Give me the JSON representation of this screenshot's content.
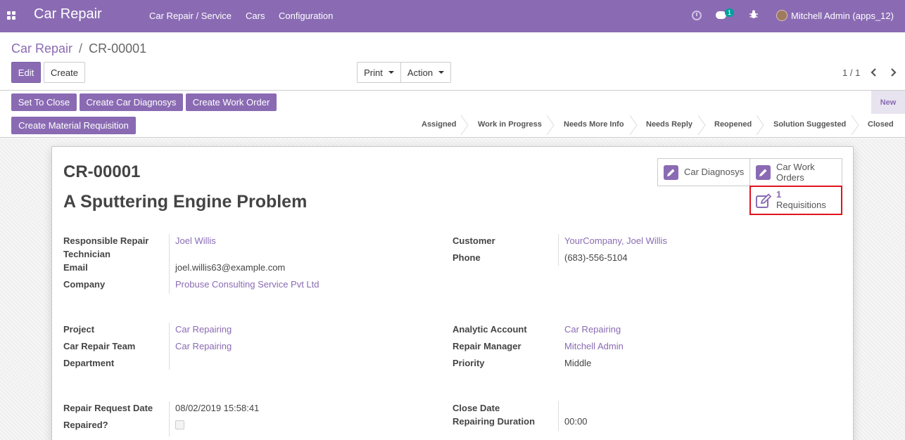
{
  "navbar": {
    "app_title": "Car Repair",
    "menu": [
      "Car Repair / Service",
      "Cars",
      "Configuration"
    ],
    "chat_count": "1",
    "user": "Mitchell Admin (apps_12)"
  },
  "breadcrumb": {
    "parent": "Car Repair",
    "separator": "/",
    "current": "CR-00001"
  },
  "buttons": {
    "edit": "Edit",
    "create": "Create",
    "print": "Print",
    "action": "Action"
  },
  "pager": "1 / 1",
  "header_buttons": {
    "set_to_close": "Set To Close",
    "create_diagnosys": "Create Car Diagnosys",
    "create_work_order": "Create Work Order",
    "create_material_requisition": "Create Material Requisition"
  },
  "stages": [
    "Assigned",
    "Work in Progress",
    "Needs More Info",
    "Needs Reply",
    "Reopened",
    "Solution Suggested",
    "Closed"
  ],
  "current_stage": "New",
  "record": {
    "name": "CR-00001",
    "subject": "A Sputtering Engine Problem"
  },
  "smart_buttons": {
    "diagnosys": "Car Diagnosys",
    "work_orders": "Car Work Orders",
    "requisitions_count": "1",
    "requisitions_label": "Requisitions"
  },
  "fields": {
    "responsible_label": "Responsible Repair Technician",
    "responsible_value": "Joel Willis",
    "email_label": "Email",
    "email_value": "joel.willis63@example.com",
    "company_label": "Company",
    "company_value": "Probuse Consulting Service Pvt Ltd",
    "customer_label": "Customer",
    "customer_value": "YourCompany, Joel Willis",
    "phone_label": "Phone",
    "phone_value": "(683)-556-5104",
    "project_label": "Project",
    "project_value": "Car Repairing",
    "team_label": "Car Repair Team",
    "team_value": "Car Repairing",
    "department_label": "Department",
    "department_value": "",
    "analytic_label": "Analytic Account",
    "analytic_value": "Car Repairing",
    "manager_label": "Repair Manager",
    "manager_value": "Mitchell Admin",
    "priority_label": "Priority",
    "priority_value": "Middle",
    "request_date_label": "Repair Request Date",
    "request_date_value": "08/02/2019 15:58:41",
    "repaired_label": "Repaired?",
    "close_date_label": "Close Date",
    "close_date_value": "",
    "duration_label": "Repairing Duration",
    "duration_value": "00:00"
  },
  "colors": {
    "brand": "#8a6bb3",
    "highlight_border": "#e0141e"
  }
}
